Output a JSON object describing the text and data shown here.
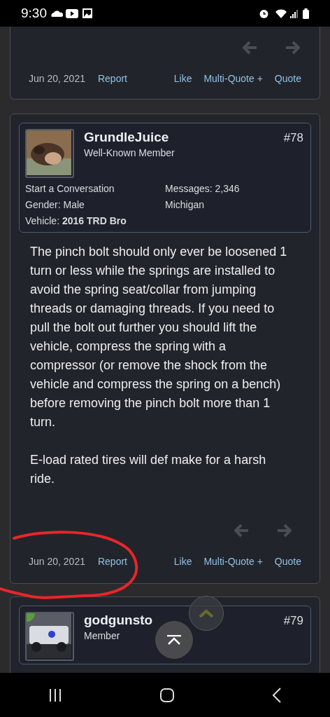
{
  "status_bar": {
    "time": "9:30"
  },
  "posts": [
    {
      "kind": "tail",
      "footer": {
        "date": "Jun 20, 2021",
        "report": "Report",
        "actions": [
          "Like",
          "Multi-Quote +",
          "Quote"
        ]
      }
    },
    {
      "kind": "full",
      "author": {
        "name": "GrundleJuice",
        "title": "Well-Known Member",
        "number": "#78",
        "start": "Start a Conversation",
        "messages_label": "Messages:",
        "messages": "2,346",
        "gender_label": "Gender:",
        "gender": "Male",
        "location": "Michigan",
        "vehicle_label": "Vehicle:",
        "vehicle": "2016 TRD Bro"
      },
      "body": [
        "The pinch bolt should only ever be loosened 1 turn or less while the springs are installed to avoid the spring seat/collar from jumping threads or damaging threads. If you need to pull the bolt out further you should lift the vehicle, compress the spring with a compressor (or remove the shock from the vehicle and compress the spring on a bench) before removing the pinch bolt more than 1 turn.",
        "E-load rated tires will def make for a harsh ride."
      ],
      "footer": {
        "date": "Jun 20, 2021",
        "report": "Report",
        "actions": [
          "Like",
          "Multi-Quote +",
          "Quote"
        ]
      }
    },
    {
      "kind": "head",
      "author": {
        "name": "godgunsto",
        "title": "Member",
        "number": "#79",
        "online": true
      }
    }
  ]
}
